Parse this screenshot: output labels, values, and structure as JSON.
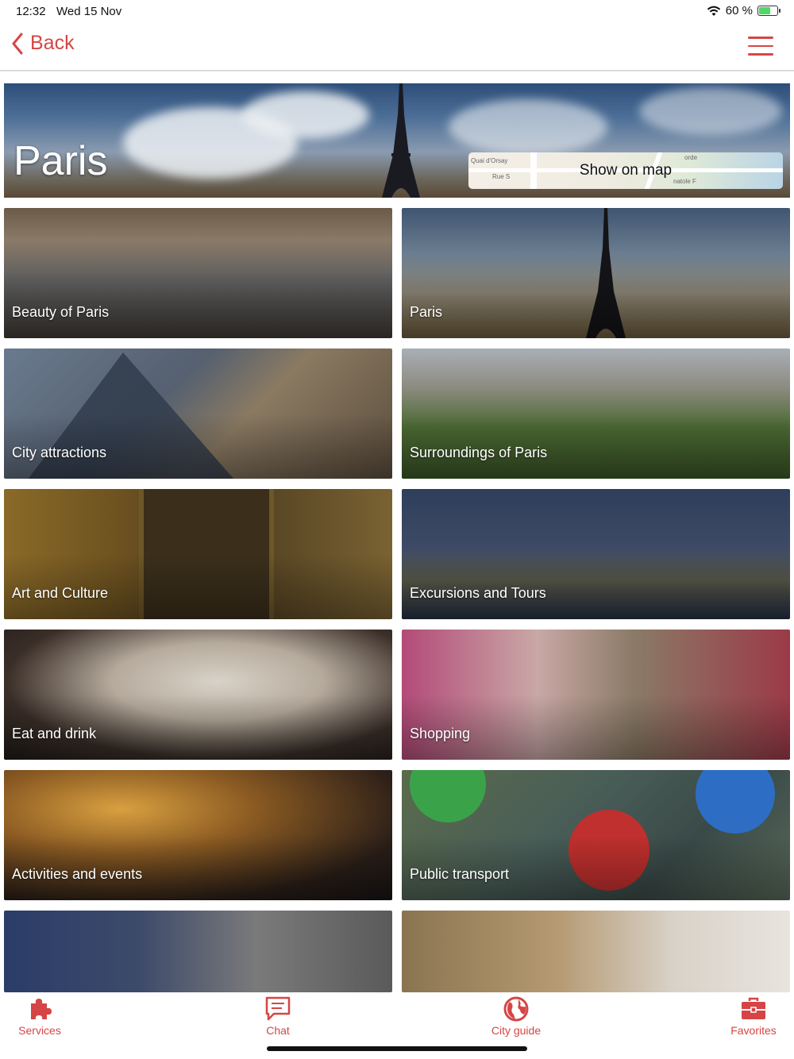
{
  "status": {
    "time": "12:32",
    "date": "Wed 15 Nov",
    "battery": "60 %",
    "battery_level": 0.6
  },
  "nav": {
    "back_label": "Back"
  },
  "hero": {
    "title": "Paris",
    "map_button": "Show on map",
    "map_streets": [
      "Quai d'Orsay",
      "Rue S",
      "orde",
      "natole F"
    ]
  },
  "tiles": [
    {
      "label": "Beauty of Paris"
    },
    {
      "label": "Paris"
    },
    {
      "label": "City attractions"
    },
    {
      "label": "Surroundings of Paris"
    },
    {
      "label": "Art and Culture"
    },
    {
      "label": "Excursions and Tours"
    },
    {
      "label": "Eat and drink"
    },
    {
      "label": "Shopping"
    },
    {
      "label": "Activities and events"
    },
    {
      "label": "Public transport"
    },
    {
      "label": ""
    },
    {
      "label": ""
    }
  ],
  "tabbar": {
    "items": [
      {
        "label": "Services",
        "icon": "puzzle-icon"
      },
      {
        "label": "Chat",
        "icon": "chat-icon"
      },
      {
        "label": "City guide",
        "icon": "globe-icon"
      },
      {
        "label": "Favorites",
        "icon": "briefcase-icon"
      }
    ]
  },
  "colors": {
    "accent": "#d64545"
  }
}
